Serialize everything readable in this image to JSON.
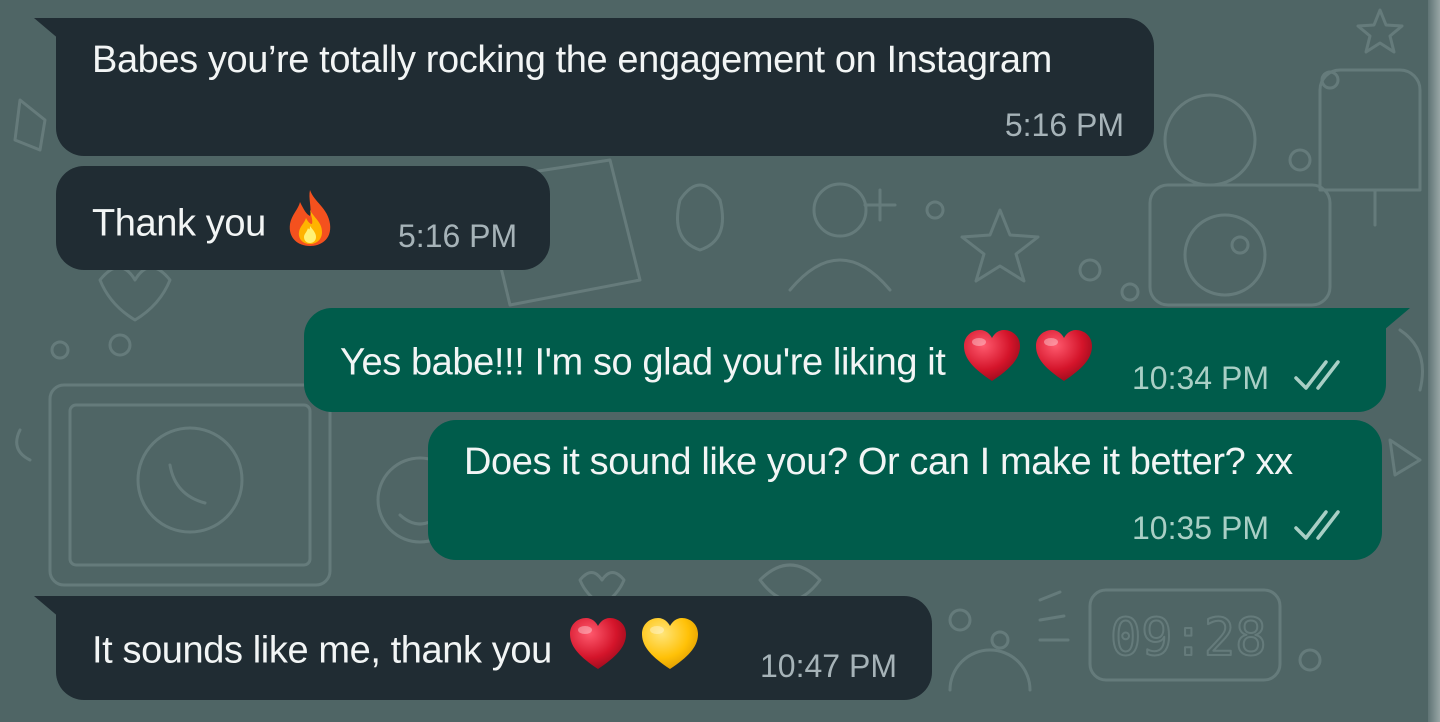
{
  "colors": {
    "wallpaper": "#4f6565",
    "incoming_bubble": "#202c33",
    "outgoing_bubble": "#005c4b",
    "read_ticks": "#a9cfc5"
  },
  "messages": [
    {
      "direction": "incoming",
      "text": "Babes you’re totally rocking the engagement on Instagram",
      "time": "5:16 PM",
      "emojis": []
    },
    {
      "direction": "incoming",
      "text": "Thank you",
      "time": "5:16 PM",
      "emojis": [
        "fire-icon"
      ]
    },
    {
      "direction": "outgoing",
      "text": "Yes babe!!! I'm so glad you're liking it",
      "time": "10:34 PM",
      "emojis": [
        "red-heart-icon",
        "red-heart-icon"
      ],
      "status": "read-double-check-icon"
    },
    {
      "direction": "outgoing",
      "text": "Does it sound like you? Or can I make it better? xx",
      "time": "10:35 PM",
      "emojis": [],
      "status": "read-double-check-icon"
    },
    {
      "direction": "incoming",
      "text": "It sounds like me, thank you",
      "time": "10:47 PM",
      "emojis": [
        "red-heart-icon",
        "yellow-heart-icon"
      ]
    }
  ]
}
